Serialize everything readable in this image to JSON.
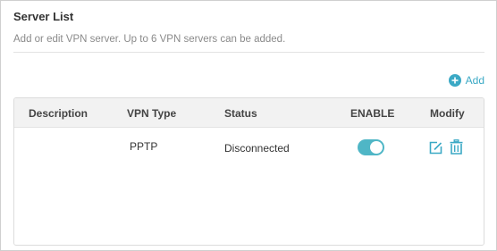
{
  "header": {
    "title": "Server List",
    "subtitle": "Add or edit VPN server. Up to 6 VPN servers can be added."
  },
  "toolbar": {
    "add_label": "Add",
    "add_icon": "plus-circle-icon"
  },
  "table": {
    "columns": [
      "Description",
      "VPN Type",
      "Status",
      "ENABLE",
      "Modify"
    ],
    "rows": [
      {
        "description": "",
        "vpn_type": "PPTP",
        "status": "Disconnected",
        "enabled": true,
        "modify_icons": [
          "edit-icon",
          "trash-icon"
        ]
      }
    ]
  },
  "colors": {
    "accent": "#3ba9c5",
    "toggle_on": "#4fb6c6",
    "header_bg": "#f2f2f2"
  }
}
